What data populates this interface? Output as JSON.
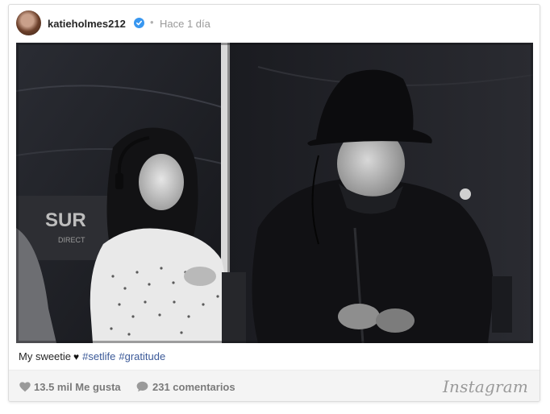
{
  "post": {
    "username": "katieholmes212",
    "timestamp": "Hace 1 día",
    "separator": "•",
    "caption": {
      "text": "My sweetie",
      "heart": "♥",
      "hashtags": [
        "#setlife",
        "#gratitude"
      ]
    },
    "photo": {
      "sign_text_1": "SUR",
      "sign_text_2": "DIRECT"
    }
  },
  "footer": {
    "likes": "13.5 mil Me gusta",
    "comments": "231 comentarios",
    "brand": "Instagram"
  },
  "colors": {
    "verified": "#3897f0",
    "hashtag": "#3b5998",
    "footer_bg": "#f4f4f4"
  }
}
